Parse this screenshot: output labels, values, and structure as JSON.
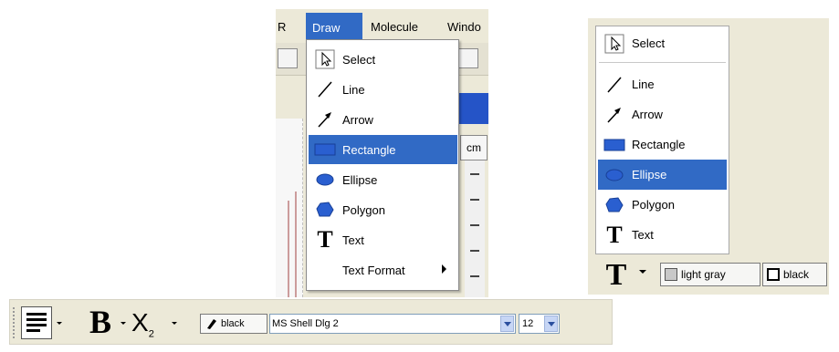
{
  "menubar": {
    "r": "R",
    "draw": "Draw",
    "molecule": "Molecule",
    "window": "Windo"
  },
  "background": {
    "cm": "cm"
  },
  "draw_menu": {
    "items": [
      {
        "label": "Select",
        "icon": "select-arrow-icon"
      },
      {
        "label": "Line",
        "icon": "line-icon"
      },
      {
        "label": "Arrow",
        "icon": "arrow-icon"
      },
      {
        "label": "Rectangle",
        "icon": "rectangle-icon",
        "highlighted": true
      },
      {
        "label": "Ellipse",
        "icon": "ellipse-icon"
      },
      {
        "label": "Polygon",
        "icon": "polygon-icon"
      },
      {
        "label": "Text",
        "icon": "text-icon"
      },
      {
        "label": "Text Format",
        "icon": "",
        "submenu": true
      }
    ]
  },
  "palette": {
    "items": [
      {
        "label": "Select",
        "icon": "select-arrow-icon"
      },
      {
        "label": "Line",
        "icon": "line-icon"
      },
      {
        "label": "Arrow",
        "icon": "arrow-icon"
      },
      {
        "label": "Rectangle",
        "icon": "rectangle-icon"
      },
      {
        "label": "Ellipse",
        "icon": "ellipse-icon",
        "highlighted": true
      },
      {
        "label": "Polygon",
        "icon": "polygon-icon"
      },
      {
        "label": "Text",
        "icon": "text-icon"
      }
    ],
    "text_tool_glyph": "T",
    "fill_label": "light gray",
    "stroke_label": "black"
  },
  "text_toolbar": {
    "bold_glyph": "B",
    "subscript_glyph": "X",
    "subscript_digit": "2",
    "font_color_label": "black",
    "font_name": "MS Shell Dlg 2",
    "font_size": "12"
  },
  "colors": {
    "highlight": "#316ac5",
    "shape_blue": "#2a5fd0",
    "toolbar_bg": "#ece9d8",
    "light_gray_swatch": "#c8c8c8",
    "black_swatch": "#000000"
  }
}
